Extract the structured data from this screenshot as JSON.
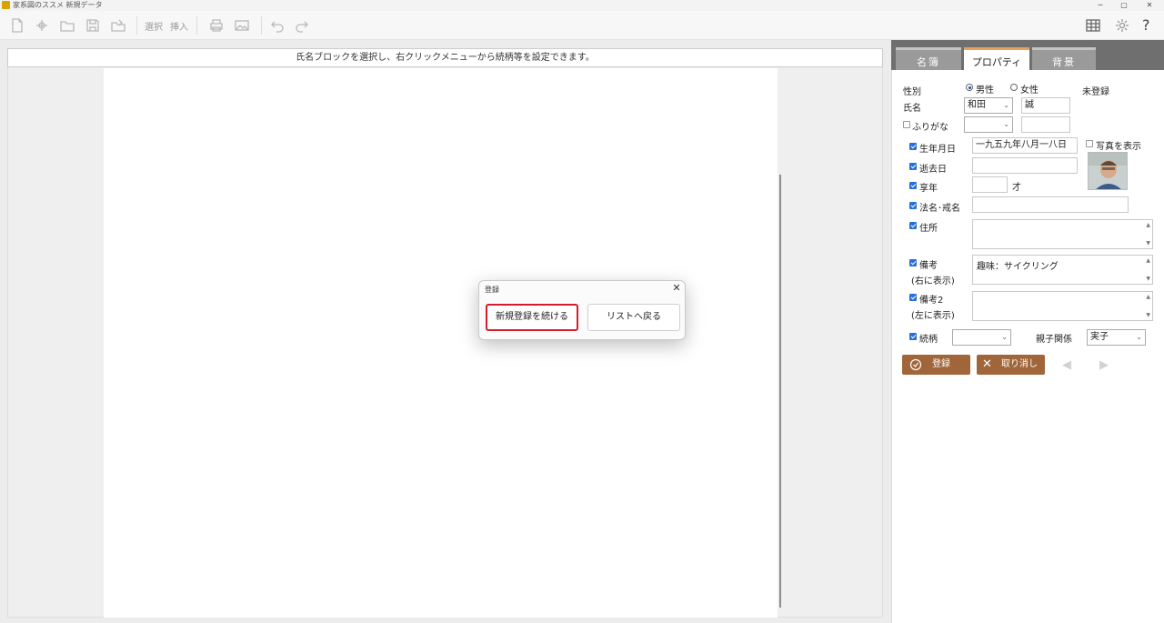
{
  "window": {
    "title": "家系図のススメ 新規データ",
    "controls": [
      "─",
      "▢",
      "✕"
    ]
  },
  "toolbar": {
    "select_label": "選択",
    "insert_label": "挿入",
    "help_label": "?"
  },
  "canvas": {
    "hint": "氏名ブロックを選択し、右クリックメニューから続柄等を設定できます。"
  },
  "dialog": {
    "title": "登録",
    "close": "✕",
    "primary_button": "新規登録を続ける",
    "secondary_button": "リストへ戻る"
  },
  "panel": {
    "tabs": [
      {
        "label": "名簿",
        "active": false
      },
      {
        "label": "プロパティ",
        "active": true
      },
      {
        "label": "背景",
        "active": false
      }
    ],
    "gender_label": "性別",
    "gender_male": "男性",
    "gender_female": "女性",
    "gender_selected": "男性",
    "status": "未登録",
    "name_label": "氏名",
    "surname": "和田",
    "given_name": "誠",
    "furigana_label": "ふりがな",
    "furigana_checked": false,
    "furigana_surname": "",
    "furigana_given": "",
    "show_photo_label": "写真を表示",
    "show_photo_checked": false,
    "birth_label": "生年月日",
    "birth_value": "一九五九年八月一八日",
    "death_label": "逝去日",
    "death_value": "",
    "age_label": "享年",
    "age_value": "",
    "age_unit": "才",
    "posthumous_label": "法名･戒名",
    "posthumous_value": "",
    "address_label": "住所",
    "address_value": "",
    "note_label": "備考",
    "note_sub": "(右に表示)",
    "note_value": "趣味：サイクリング",
    "note2_label": "備考2",
    "note2_sub": "(左に表示)",
    "note2_value": "",
    "relation_label": "続柄",
    "relation_value": "",
    "parent_rel_label": "親子関係",
    "parent_rel_value": "実子",
    "register_button": "登録",
    "cancel_button": "取り消し",
    "prev_arrow": "◀",
    "next_arrow": "▶",
    "accent_color": "#a0663a"
  }
}
